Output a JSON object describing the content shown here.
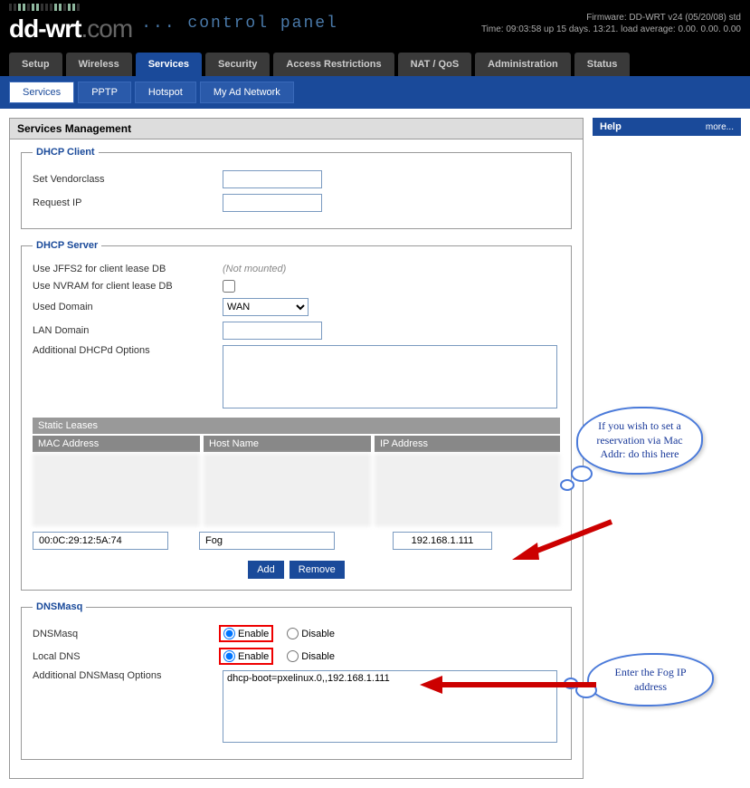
{
  "header": {
    "logo_main": "dd-wrt",
    "logo_suffix": ".com",
    "tagline": "... control panel",
    "firmware": "Firmware: DD-WRT v24 (05/20/08) std",
    "time_status": "Time: 09:03:58 up 15 days. 13:21. load average: 0.00. 0.00. 0.00"
  },
  "main_tabs": [
    "Setup",
    "Wireless",
    "Services",
    "Security",
    "Access Restrictions",
    "NAT / QoS",
    "Administration",
    "Status"
  ],
  "main_tab_active": 2,
  "sub_tabs": [
    "Services",
    "PPTP",
    "Hotspot",
    "My Ad Network"
  ],
  "sub_tab_active": 0,
  "page_title": "Services Management",
  "help": {
    "title": "Help",
    "more": "more..."
  },
  "dhcp_client": {
    "legend": "DHCP Client",
    "vendorclass_label": "Set Vendorclass",
    "vendorclass_value": "",
    "request_ip_label": "Request IP",
    "request_ip_value": ""
  },
  "dhcp_server": {
    "legend": "DHCP Server",
    "jffs2_label": "Use JFFS2 for client lease DB",
    "jffs2_status": "(Not mounted)",
    "nvram_label": "Use NVRAM for client lease DB",
    "nvram_checked": false,
    "used_domain_label": "Used Domain",
    "used_domain_value": "WAN",
    "lan_domain_label": "LAN Domain",
    "lan_domain_value": "",
    "additional_label": "Additional DHCPd Options",
    "additional_value": "",
    "static_leases_title": "Static Leases",
    "col_mac": "MAC Address",
    "col_host": "Host Name",
    "col_ip": "IP Address",
    "lease_mac": "00:0C:29:12:5A:74",
    "lease_host": "Fog",
    "lease_ip": "192.168.1.111",
    "btn_add": "Add",
    "btn_remove": "Remove"
  },
  "dnsmasq": {
    "legend": "DNSMasq",
    "dnsmasq_label": "DNSMasq",
    "localdns_label": "Local DNS",
    "enable_label": "Enable",
    "disable_label": "Disable",
    "dnsmasq_value": "enable",
    "localdns_value": "enable",
    "additional_label": "Additional DNSMasq Options",
    "additional_value": "dhcp-boot=pxelinux.0,,192.168.1.111"
  },
  "callouts": {
    "reservation": "If you wish to set a reservation via Mac Addr: do this here",
    "fog_ip": "Enter the Fog IP address"
  }
}
